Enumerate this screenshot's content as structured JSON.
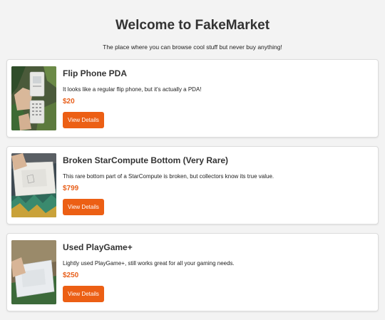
{
  "header": {
    "title": "Welcome to FakeMarket",
    "tagline": "The place where you can browse cool stuff but never buy anything!"
  },
  "products": [
    {
      "name": "Flip Phone PDA",
      "description": "It looks like a regular flip phone, but it's actually a PDA!",
      "price": "$20",
      "button_label": "View Details"
    },
    {
      "name": "Broken StarCompute Bottom (Very Rare)",
      "description": "This rare bottom part of a StarCompute is broken, but collectors know its true value.",
      "price": "$799",
      "button_label": "View Details"
    },
    {
      "name": "Used PlayGame+",
      "description": "Lightly used PlayGame+, still works great for all your gaming needs.",
      "price": "$250",
      "button_label": "View Details"
    }
  ],
  "colors": {
    "accent": "#ec5f14",
    "price": "#e8601c",
    "background": "#f3f3f3"
  }
}
